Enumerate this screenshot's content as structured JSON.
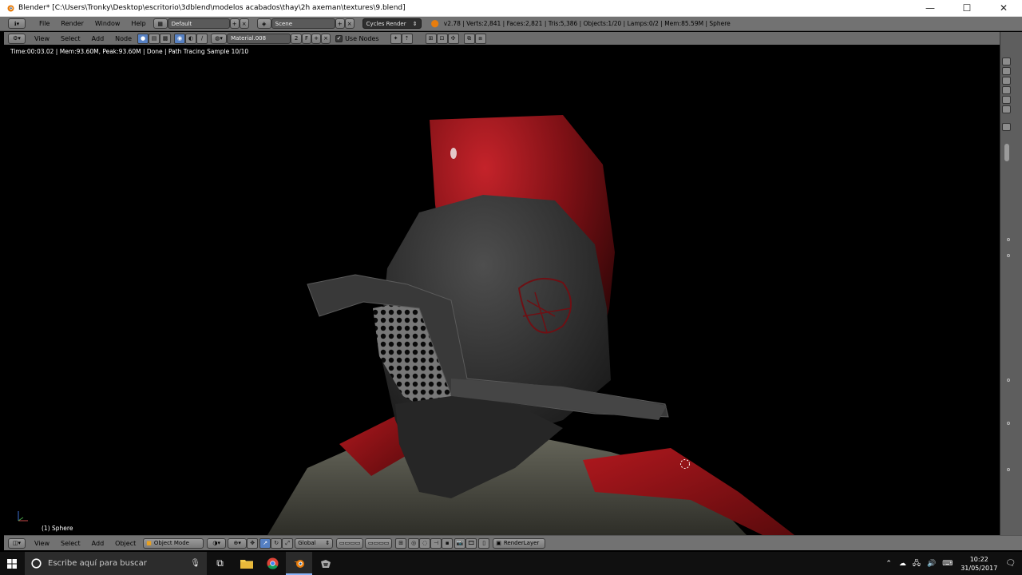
{
  "window": {
    "title": "Blender* [C:\\Users\\Tronky\\Desktop\\escritorio\\3dblend\\modelos acabados\\thay\\2h axeman\\textures\\9.blend]",
    "minimize": "—",
    "maximize": "☐",
    "close": "✕"
  },
  "info_header": {
    "menus": [
      "File",
      "Render",
      "Window",
      "Help"
    ],
    "layout": "Default",
    "scene": "Scene",
    "engine": "Cycles Render",
    "stats": "v2.78 | Verts:2,841 | Faces:2,821 | Tris:5,386 | Objects:1/20 | Lamps:0/2 | Mem:85.59M | Sphere"
  },
  "node_header": {
    "menus": [
      "View",
      "Select",
      "Add",
      "Node"
    ],
    "material": "Material.008",
    "users": "2",
    "fake_user": "F",
    "use_nodes_label": "Use Nodes",
    "use_nodes_checked": true
  },
  "viewport": {
    "render_status": "Time:00:03.02 | Mem:93.60M, Peak:93.60M | Done | Path Tracing Sample 10/10",
    "object_label": "(1) Sphere"
  },
  "view_header": {
    "menus": [
      "View",
      "Select",
      "Add",
      "Object"
    ],
    "mode": "Object Mode",
    "orientation": "Global",
    "render_layer": "RenderLayer"
  },
  "taskbar": {
    "search_placeholder": "Escribe aquí para buscar",
    "time": "10:22",
    "date": "31/05/2017"
  },
  "colors": {
    "blender_header": "#727272",
    "viewport_bg": "#000000",
    "helmet_red": "#8c1014",
    "helmet_dark": "#2b2b2b",
    "taskbar": "#101010"
  }
}
